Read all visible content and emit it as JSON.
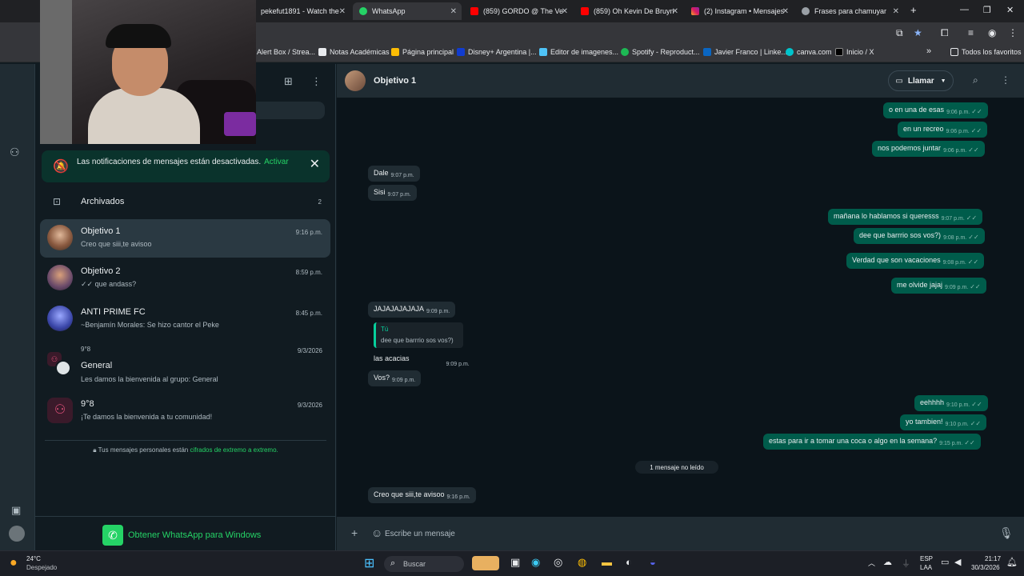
{
  "browser": {
    "tabs": [
      {
        "label": "pekefut1891 - Watch the"
      },
      {
        "label": "WhatsApp"
      },
      {
        "label": "(859) GORDO @ The Vers"
      },
      {
        "label": "(859) Oh Kevin De Bruyne"
      },
      {
        "label": "(2) Instagram • Mensajes"
      },
      {
        "label": "Frases para chamuyar"
      }
    ],
    "new_tab": "+",
    "window": {
      "minimize": "—",
      "maximize": "❐",
      "close": "✕"
    },
    "bookmarks": [
      {
        "label": "Alert Box / Strea..."
      },
      {
        "label": "Notas Académicas"
      },
      {
        "label": "Página principal"
      },
      {
        "label": "Disney+ Argentina |..."
      },
      {
        "label": "Editor de imagenes..."
      },
      {
        "label": "Spotify - Reproduct..."
      },
      {
        "label": "Javier Franco | Linke..."
      },
      {
        "label": "canva.com"
      },
      {
        "label": "Inicio / X"
      }
    ],
    "bookmarks_more": "»",
    "all_bookmarks": "Todos los favoritos"
  },
  "whatsapp": {
    "notification": {
      "text": "Las notificaciones de mensajes están desactivadas.",
      "action": "Activar"
    },
    "archived": {
      "label": "Archivados",
      "count": "2"
    },
    "chats": [
      {
        "name": "Objetivo 1",
        "preview": "Creo que siii,te avisoo",
        "time": "9:16 p.m."
      },
      {
        "name": "Objetivo 2",
        "preview": "✓✓ que andass?",
        "time": "8:59 p.m."
      },
      {
        "name": "ANTI PRIME FC",
        "preview": "~Benjamín Morales: Se hizo cantor el Peke",
        "time": "8:45 p.m."
      },
      {
        "pre": "9°8",
        "name": "General",
        "preview": "Les damos la bienvenida al grupo: General",
        "time": "9/3/2026"
      },
      {
        "name": "9°8",
        "preview": "¡Te damos la bienvenida a tu comunidad!",
        "time": "9/3/2026"
      }
    ],
    "e2e": {
      "text": "Tus mensajes personales están",
      "link": "cifrados de extremo a extremo."
    },
    "get_windows": "Obtener WhatsApp para Windows",
    "chat": {
      "title": "Objetivo 1",
      "call_label": "Llamar",
      "messages": [
        {
          "dir": "out",
          "text": "o en una de esas",
          "time": "9:06 p.m."
        },
        {
          "dir": "out",
          "text": "en un recreo",
          "time": "9:06 p.m."
        },
        {
          "dir": "out",
          "text": "nos podemos juntar",
          "time": "9:06 p.m."
        },
        {
          "dir": "in",
          "text": "Dale",
          "time": "9:07 p.m."
        },
        {
          "dir": "in",
          "text": "Sisi",
          "time": "9:07 p.m."
        },
        {
          "dir": "out",
          "text": "mañana lo hablamos si queresss",
          "time": "9:07 p.m."
        },
        {
          "dir": "out",
          "text": "dee que barrrio sos vos?)",
          "time": "9:08 p.m."
        },
        {
          "dir": "out",
          "text": "Verdad que son vacaciones",
          "time": "9:08 p.m."
        },
        {
          "dir": "out",
          "text": "me olvide jajaj",
          "time": "9:09 p.m."
        },
        {
          "dir": "in",
          "text": "JAJAJAJAJAJA",
          "time": "9:09 p.m."
        },
        {
          "dir": "in",
          "text": "las acacias",
          "time": "9:09 p.m."
        },
        {
          "dir": "in",
          "text": "Vos?",
          "time": "9:09 p.m."
        },
        {
          "dir": "out",
          "text": "eehhhh",
          "time": "9:10 p.m."
        },
        {
          "dir": "out",
          "text": "yo tambien!",
          "time": "9:10 p.m."
        },
        {
          "dir": "out",
          "text": "estas para ir a tomar una coca o algo en la semana?",
          "time": "9:15 p.m."
        },
        {
          "dir": "in",
          "text": "Creo que siii,te avisoo",
          "time": "9:16 p.m."
        }
      ],
      "quote": {
        "author": "Tú",
        "text": "dee que barrrio sos vos?)"
      },
      "unread": "1 mensaje no leído",
      "composer_placeholder": "Escribe un mensaje"
    }
  },
  "taskbar": {
    "weather_temp": "24°C",
    "weather_desc": "Despejado",
    "search": "Buscar",
    "lang": "ESP",
    "layout": "LAA",
    "time": "21:17",
    "date": "30/3/2026"
  },
  "colors": {
    "accent": "#25d366",
    "outgoing_bubble": "#005c4b",
    "incoming_bubble": "#202c33",
    "app_bg": "#111b21"
  }
}
